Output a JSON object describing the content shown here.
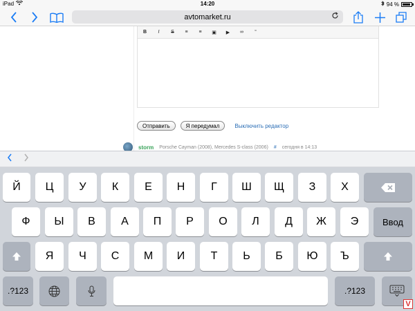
{
  "status": {
    "device": "iPad",
    "time": "14:20",
    "battery": "94 %",
    "battery_level": 0.94
  },
  "browser": {
    "url": "avtomarket.ru"
  },
  "editor": {
    "tools": [
      "B",
      "I",
      "S",
      "≡",
      "≡",
      "▣",
      "▶",
      "∞",
      "“"
    ]
  },
  "buttons": {
    "send": "Отправить",
    "cancel": "Я передумал",
    "disable_editor": "Выключить редактор"
  },
  "comment": {
    "user": "storm",
    "cars": "Porsche Cayman (2008), Mercedes S-class (2006)",
    "hash": "#",
    "time": "сегодня в 14:13"
  },
  "keyboard": {
    "row1": [
      "Й",
      "Ц",
      "У",
      "К",
      "Е",
      "Н",
      "Г",
      "Ш",
      "Щ",
      "З",
      "Х"
    ],
    "row2": [
      "Ф",
      "Ы",
      "В",
      "А",
      "П",
      "Р",
      "О",
      "Л",
      "Д",
      "Ж",
      "Э"
    ],
    "row3": [
      "Я",
      "Ч",
      "С",
      "М",
      "И",
      "Т",
      "Ь",
      "Б",
      "Ю",
      "Ъ"
    ],
    "return_label": "Ввод",
    "numbers_label": ".?123"
  },
  "badge": "V"
}
